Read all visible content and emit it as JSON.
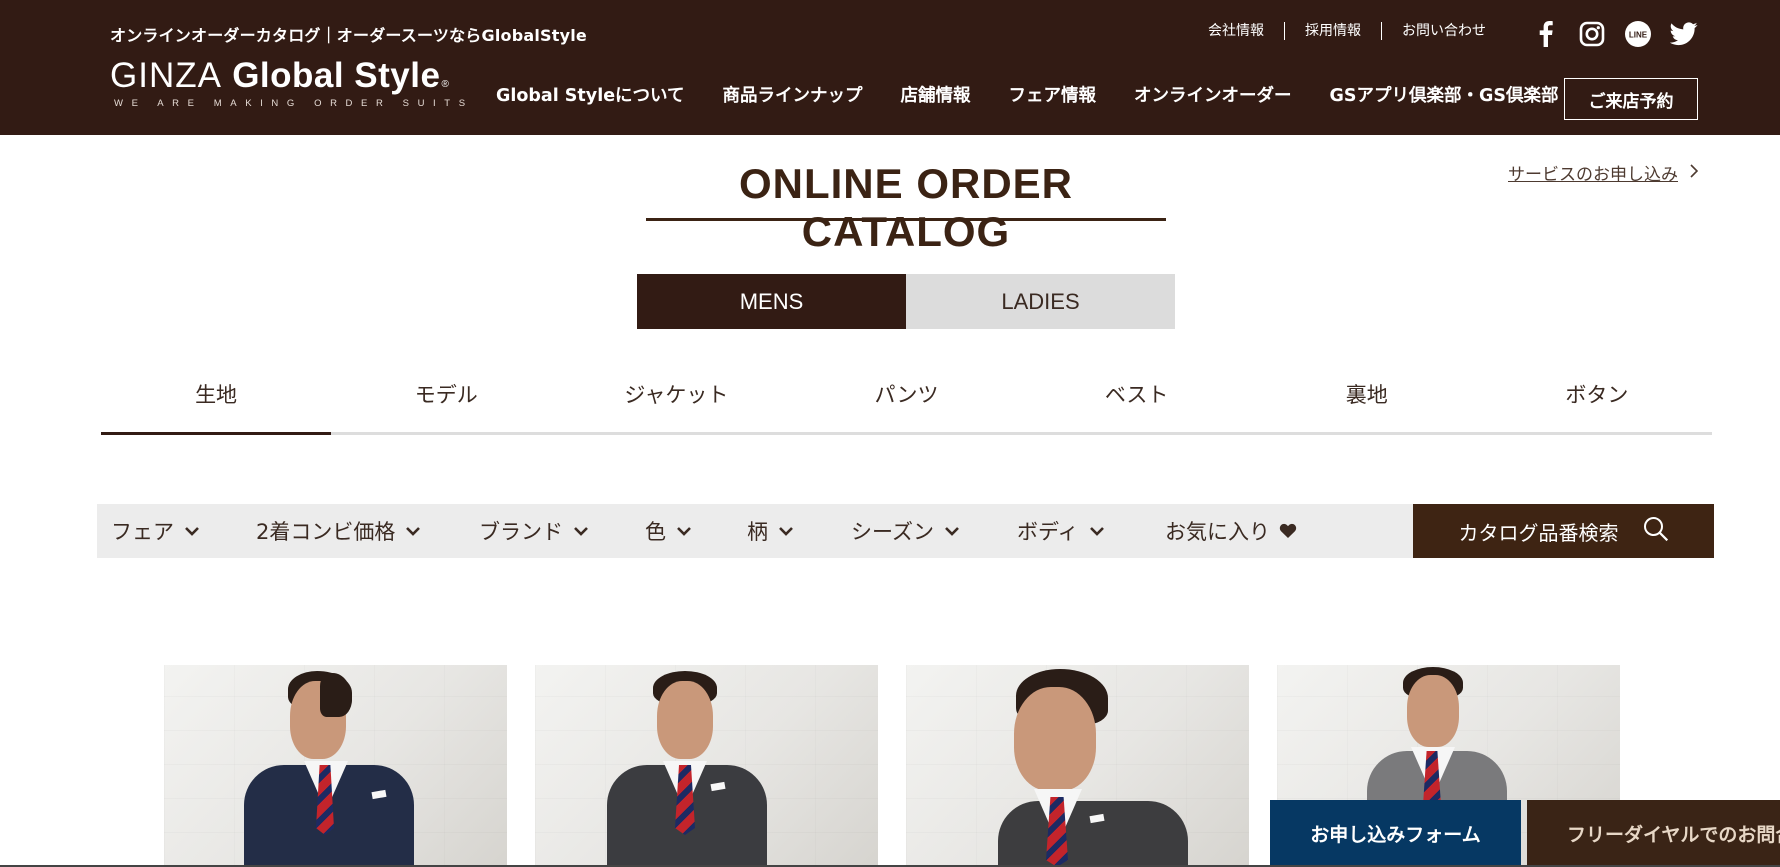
{
  "header": {
    "tagline": "オンラインオーダーカタログ｜オーダースーツならGlobalStyle",
    "logo_thin": "GINZA",
    "logo_bold": "Global Style",
    "logo_reg": "®",
    "logo_sub": "WE ARE MAKING ORDER SUITS",
    "utility_links": [
      "会社情報",
      "採用情報",
      "お問い合わせ"
    ],
    "social_icons": [
      "facebook-icon",
      "instagram-icon",
      "line-icon",
      "twitter-icon"
    ],
    "line_label": "LINE",
    "nav": [
      "Global Styleについて",
      "商品ラインナップ",
      "店舗情報",
      "フェア情報",
      "オンラインオーダー",
      "GSアプリ倶楽部・GS倶楽部"
    ],
    "reserve_label": "ご来店予約",
    "background_color": "#321b14"
  },
  "main": {
    "title": "ONLINE ORDER CATALOG",
    "service_link": "サービスのお申し込み",
    "gender_tabs": [
      {
        "label": "MENS",
        "active": true
      },
      {
        "label": "LADIES",
        "active": false
      }
    ],
    "category_tabs": [
      {
        "label": "生地",
        "active": true
      },
      {
        "label": "モデル",
        "active": false
      },
      {
        "label": "ジャケット",
        "active": false
      },
      {
        "label": "パンツ",
        "active": false
      },
      {
        "label": "ベスト",
        "active": false
      },
      {
        "label": "裏地",
        "active": false
      },
      {
        "label": "ボタン",
        "active": false
      }
    ],
    "filters": [
      "フェア",
      "2着コンビ価格",
      "ブランド",
      "色",
      "柄",
      "シーズン",
      "ボディ",
      "お気に入り"
    ],
    "search_label": "カタログ品番検索",
    "products": [
      {
        "suit_color": "#232d47",
        "pose": "profile"
      },
      {
        "suit_color": "#3b3c40",
        "pose": "front"
      },
      {
        "suit_color": "#3d3d3f",
        "pose": "closeup"
      },
      {
        "suit_color": "#7a7a7c",
        "pose": "front"
      }
    ]
  },
  "floating": {
    "apply_label": "お申し込みフォーム",
    "dial_label": "フリーダイヤルでのお問合せ",
    "apply_color": "#063863",
    "dial_color": "#3a2416"
  }
}
